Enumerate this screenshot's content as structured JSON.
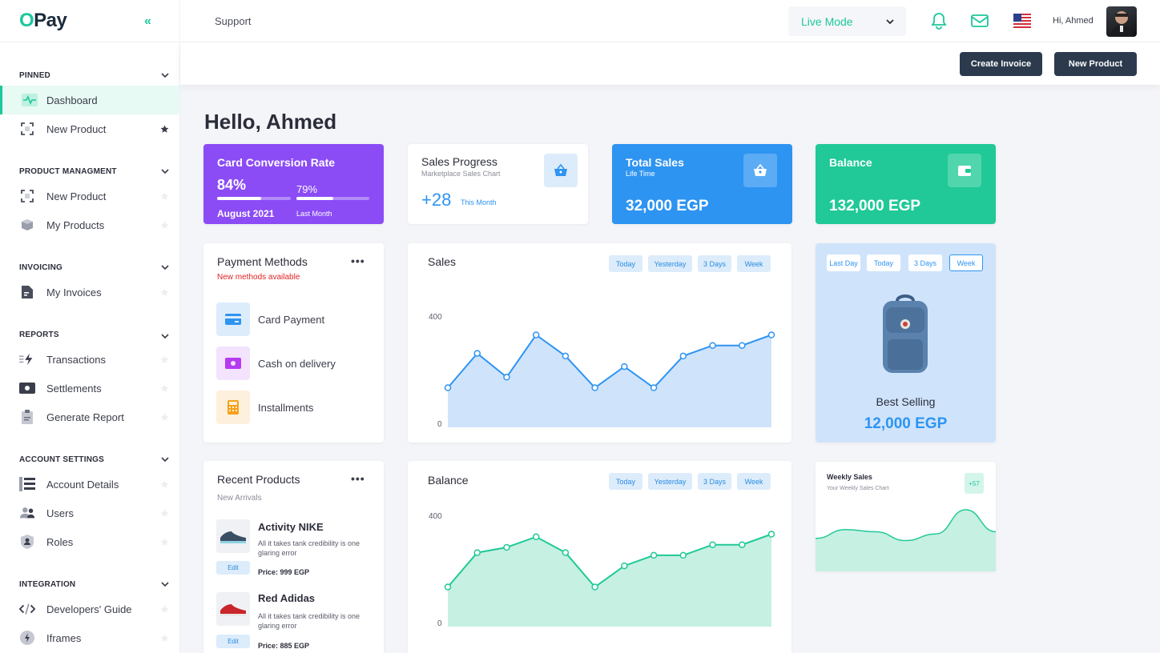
{
  "app": {
    "logo_prefix": "O",
    "logo_rest": "Pay"
  },
  "sidebar": {
    "sections": [
      {
        "title": "PINNED"
      },
      {
        "title": "PRODUCT MANAGMENT"
      },
      {
        "title": "INVOICING"
      },
      {
        "title": "REPORTS"
      },
      {
        "title": "ACCOUNT SETTINGS"
      },
      {
        "title": "INTEGRATION"
      }
    ],
    "items": [
      {
        "label": "Dashboard",
        "icon": "activity-icon",
        "active": true
      },
      {
        "label": "New Product",
        "icon": "scan-icon",
        "starred": true
      },
      {
        "label": "New Product",
        "icon": "scan-icon"
      },
      {
        "label": "My Products",
        "icon": "box-icon"
      },
      {
        "label": "My Invoices",
        "icon": "document-icon"
      },
      {
        "label": "Transactions",
        "icon": "bolt-transfer-icon"
      },
      {
        "label": "Settlements",
        "icon": "cash-icon"
      },
      {
        "label": "Generate Report",
        "icon": "clipboard-icon"
      },
      {
        "label": "Account Details",
        "icon": "list-icon"
      },
      {
        "label": "Users",
        "icon": "users-icon"
      },
      {
        "label": "Roles",
        "icon": "badge-icon"
      },
      {
        "label": "Developers' Guide",
        "icon": "code-icon"
      },
      {
        "label": "Iframes",
        "icon": "bolt-circle-icon"
      }
    ]
  },
  "topbar": {
    "support": "Support",
    "mode": "Live Mode",
    "greeting": "Hi, Ahmed"
  },
  "actions": {
    "create_invoice": "Create Invoice",
    "new_product": "New Product"
  },
  "hello": "Hello, Ahmed",
  "cards": {
    "conversion": {
      "title": "Card Conversion Rate",
      "current": "84%",
      "current_fill": 0.6,
      "previous": "79%",
      "previous_fill": 0.5,
      "current_label": "August 2021",
      "previous_label": "Last Month",
      "color": "#8b4cf6"
    },
    "progress": {
      "title": "Sales Progress",
      "subtitle": "Marketplace Sales Chart",
      "value": "+28",
      "period": "This Month"
    },
    "total": {
      "title": "Total Sales",
      "subtitle": "Life Time",
      "value": "32,000 EGP",
      "color": "#2e94f2"
    },
    "balance": {
      "title": "Balance",
      "value": "132,000 EGP",
      "color": "#20c997"
    }
  },
  "payment_methods": {
    "title": "Payment Methods",
    "subtitle": "New methods available",
    "items": [
      {
        "label": "Card Payment",
        "icon": "credit-card-icon"
      },
      {
        "label": "Cash on delivery",
        "icon": "cash-icon"
      },
      {
        "label": "Installments",
        "icon": "calculator-icon"
      }
    ]
  },
  "sales": {
    "title": "Sales",
    "filters": [
      "Today",
      "Yesterday",
      "3 Days",
      "Week"
    ]
  },
  "balance_chart": {
    "title": "Balance",
    "filters": [
      "Today",
      "Yesterday",
      "3 Days",
      "Week"
    ]
  },
  "best_selling": {
    "filters": [
      "Last Day",
      "Today",
      "3 Days",
      "Week"
    ],
    "selected": "Week",
    "label": "Best Selling",
    "value": "12,000 EGP"
  },
  "recent_products": {
    "title": "Recent Products",
    "subtitle": "New Arrivals",
    "items": [
      {
        "name": "Activity NIKE",
        "desc": "All it takes tank credibility is one glaring error",
        "price": "Price: 999 EGP",
        "edit": "Edit"
      },
      {
        "name": "Red Adidas",
        "desc": "All it takes tank credibility is one glaring error",
        "price": "Price: 885 EGP",
        "edit": "Edit"
      }
    ]
  },
  "weekly": {
    "title": "Weekly Sales",
    "subtitle": "Your Weekly Sales Chart",
    "badge": "+57"
  },
  "chart_data": [
    {
      "type": "area",
      "title": "Sales",
      "y_ticks": [
        "0",
        "400"
      ],
      "ylim": [
        0,
        400
      ],
      "values": [
        150,
        280,
        190,
        350,
        270,
        150,
        230,
        150,
        270,
        310,
        310,
        350
      ],
      "color": "#2e94f2"
    },
    {
      "type": "area",
      "title": "Balance",
      "y_ticks": [
        "0",
        "400"
      ],
      "ylim": [
        0,
        400
      ],
      "values": [
        150,
        280,
        300,
        340,
        280,
        150,
        230,
        270,
        270,
        310,
        310,
        350
      ],
      "color": "#20c997"
    },
    {
      "type": "area",
      "title": "Weekly Sales",
      "values": [
        0.35,
        0.55,
        0.5,
        0.3,
        0.45,
        1.0,
        0.5
      ],
      "color": "#20c997"
    }
  ]
}
